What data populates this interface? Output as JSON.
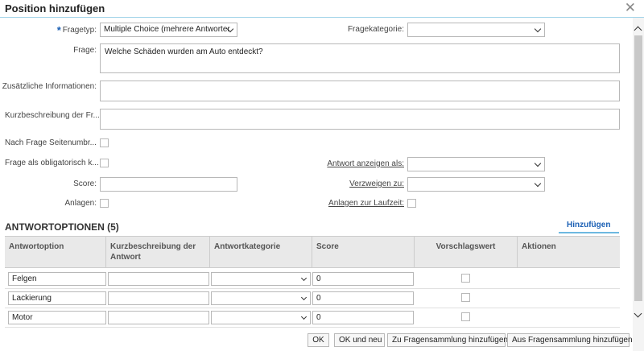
{
  "dialog": {
    "title": "Position hinzufügen",
    "close_glyph": "✕"
  },
  "form": {
    "fragetyp": {
      "label": "Fragetyp:",
      "required_mark": "*",
      "value": "Multiple Choice (mehrere Antworter"
    },
    "fragekategorie": {
      "label": "Fragekategorie:",
      "value": ""
    },
    "frage": {
      "label": "Frage:",
      "value": "Welche Schäden wurden am Auto entdeckt?"
    },
    "zusatz": {
      "label": "Zusätzliche Informationen:",
      "value": ""
    },
    "kurzbeschreibung": {
      "label": "Kurzbeschreibung der Fr...",
      "value": ""
    },
    "seitenumbruch": {
      "label": "Nach Frage Seitenumbr...",
      "checked": false
    },
    "obligatorisch": {
      "label": "Frage als obligatorisch k...",
      "checked": false
    },
    "antwort_anzeigen": {
      "label": "Antwort anzeigen als:",
      "value": ""
    },
    "score": {
      "label": "Score:",
      "value": ""
    },
    "verzweigen": {
      "label": "Verzweigen zu:",
      "value": ""
    },
    "anlagen": {
      "label": "Anlagen:",
      "checked": false
    },
    "anlagen_laufzeit": {
      "label": "Anlagen zur Laufzeit:",
      "checked": false
    }
  },
  "answers": {
    "title": "ANTWORTOPTIONEN (5)",
    "add_label": "Hinzufügen",
    "columns": [
      "Antwortoption",
      "Kurzbeschreibung der Antwort",
      "Antwortkategorie",
      "Score",
      "Vorschlagswert",
      "Aktionen"
    ],
    "rows": [
      {
        "option": "Felgen",
        "short": "",
        "category": "",
        "score": "0",
        "default": false
      },
      {
        "option": "Lackierung",
        "short": "",
        "category": "",
        "score": "0",
        "default": false
      },
      {
        "option": "Motor",
        "short": "",
        "category": "",
        "score": "0",
        "default": false
      }
    ]
  },
  "footer": {
    "ok": "OK",
    "ok_new": "OK und neu",
    "add_to_collection": "Zu Fragensammlung hinzufügen",
    "from_collection": "Aus Fragensammlung hinzufügen"
  },
  "colors": {
    "accent": "#1a5fb4",
    "title_underline": "#9fd3e8",
    "header_bg": "#e9e9e9"
  }
}
